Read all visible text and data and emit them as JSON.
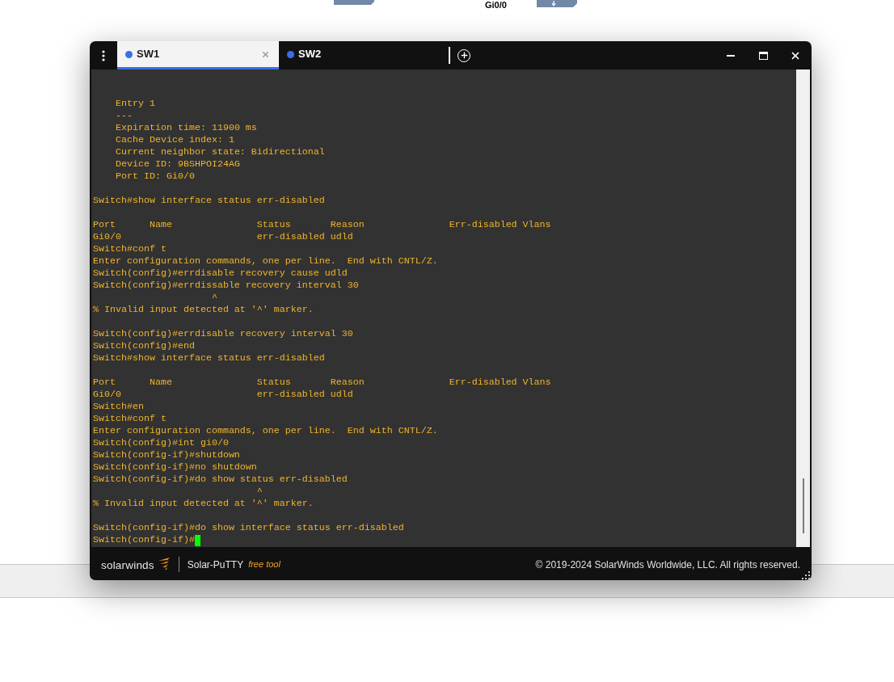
{
  "background": {
    "port_label": "Gi0/0"
  },
  "window": {
    "tabs": [
      {
        "label": "SW1",
        "selected": true
      },
      {
        "label": "SW2",
        "selected": false
      }
    ]
  },
  "terminal": {
    "blocks": [
      [
        "    Entry 1",
        "    ---",
        "    Expiration time: 11900 ms",
        "    Cache Device index: 1",
        "    Current neighbor state: Bidirectional",
        "    Device ID: 9BSHPOI24AG",
        "    Port ID: Gi0/0"
      ],
      [
        "Switch#show interface status err-disabled"
      ],
      [
        "Port      Name               Status       Reason               Err-disabled Vlans",
        "Gi0/0                        err-disabled udld",
        "Switch#conf t",
        "Enter configuration commands, one per line.  End with CNTL/Z.",
        "Switch(config)#errdisable recovery cause udld",
        "Switch(config)#errdissable recovery interval 30",
        "                     ^",
        "% Invalid input detected at '^' marker."
      ],
      [
        "Switch(config)#errdisable recovery interval 30",
        "Switch(config)#end",
        "Switch#show interface status err-disabled"
      ],
      [
        "Port      Name               Status       Reason               Err-disabled Vlans",
        "Gi0/0                        err-disabled udld",
        "Switch#en",
        "Switch#conf t",
        "Enter configuration commands, one per line.  End with CNTL/Z.",
        "Switch(config)#int gi0/0",
        "Switch(config-if)#shutdown",
        "Switch(config-if)#no shutdown",
        "Switch(config-if)#do show status err-disabled",
        "                             ^",
        "% Invalid input detected at '^' marker."
      ],
      [
        "Switch(config-if)#do show interface status err-disabled"
      ]
    ],
    "prompt": "Switch(config-if)#",
    "cursor_visible": true
  },
  "footer": {
    "brand": "solarwinds",
    "product": "Solar-PuTTY",
    "edition": "free tool",
    "copyright": "© 2019-2024 SolarWinds Worldwide, LLC. All rights reserved."
  }
}
